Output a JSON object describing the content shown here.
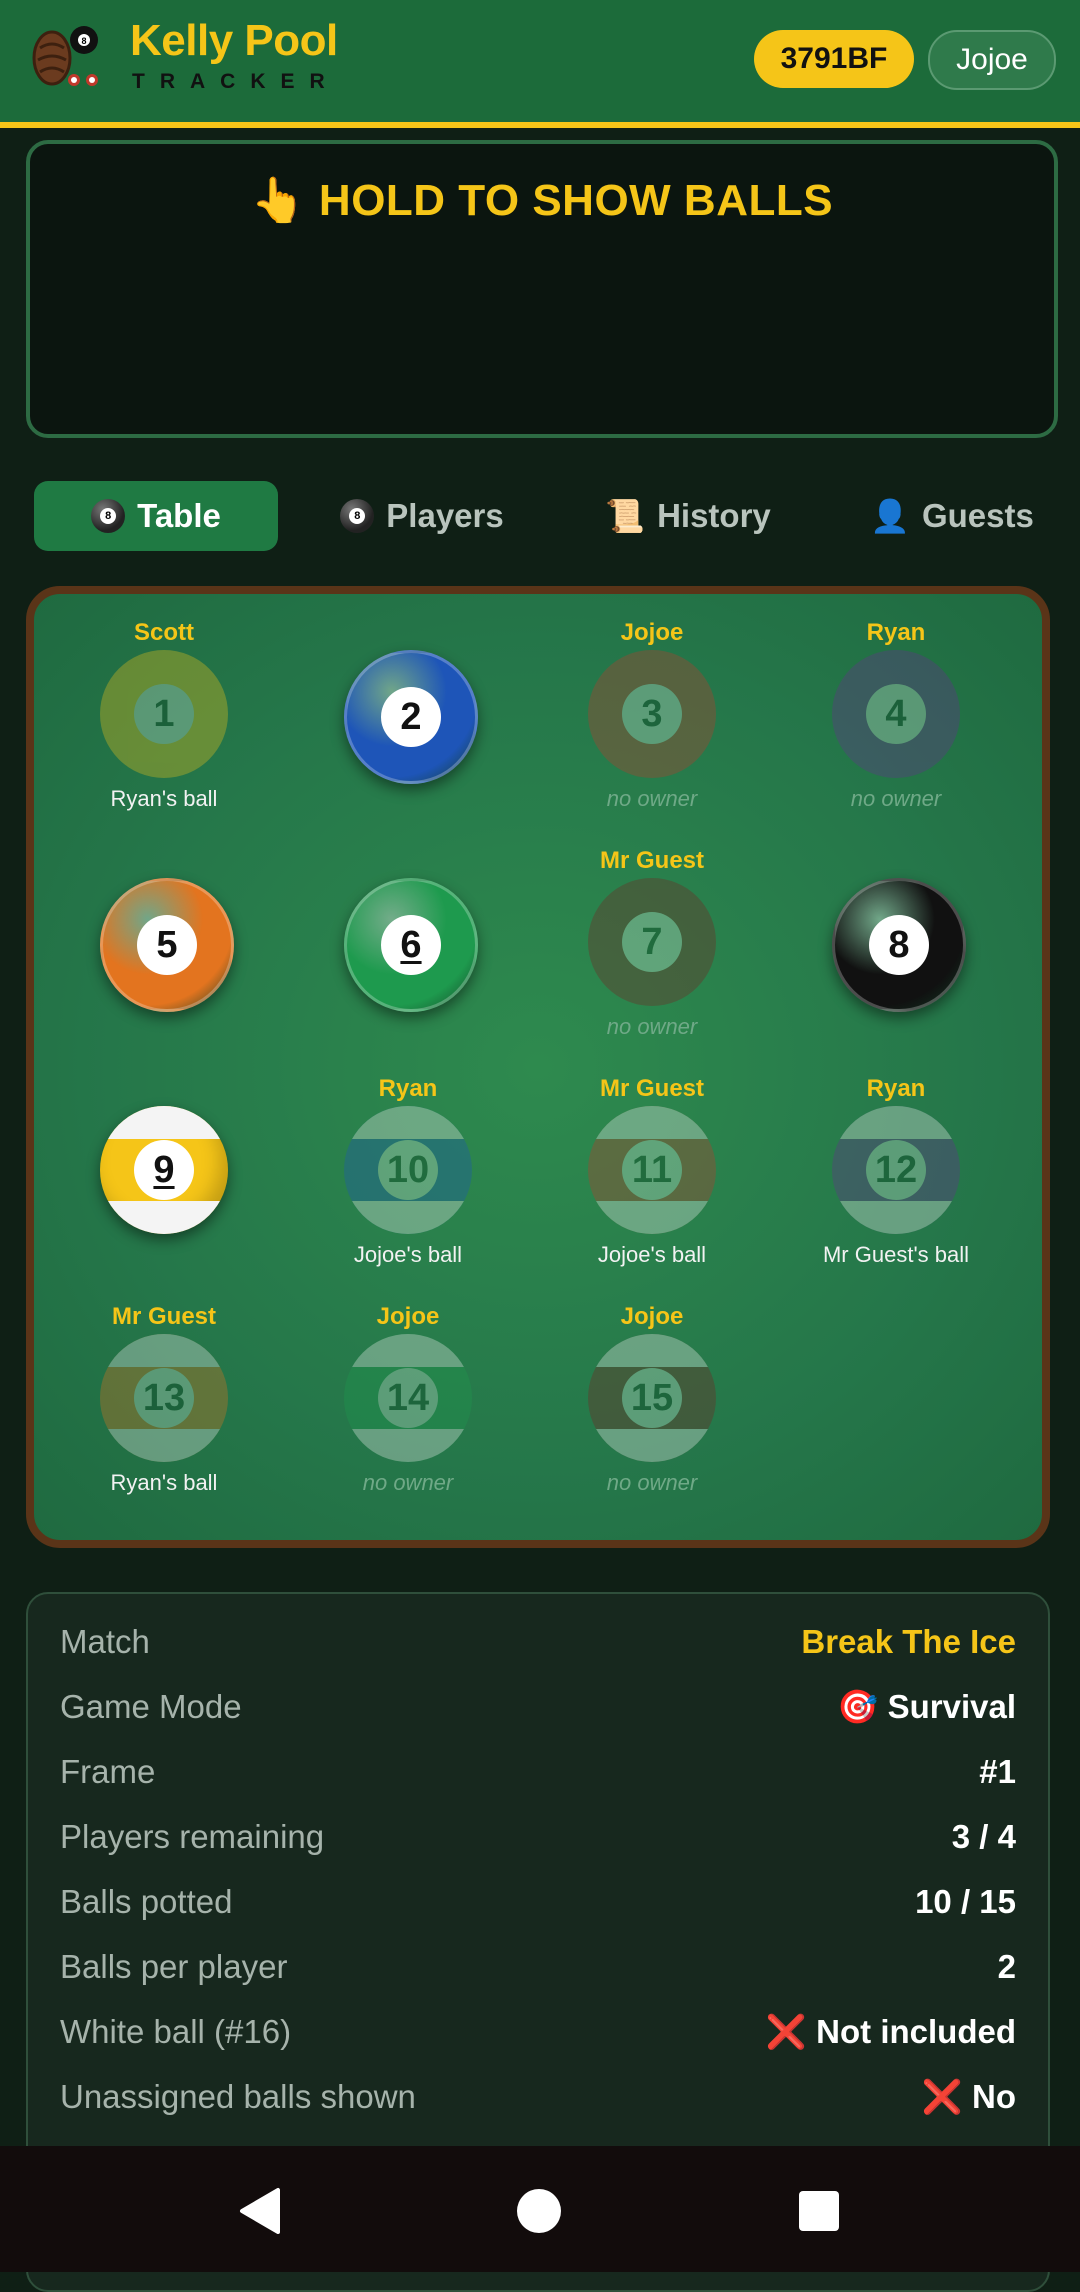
{
  "header": {
    "title": "Kelly Pool",
    "subtitle": "TRACKER",
    "room_code": "3791BF",
    "user": "Jojoe"
  },
  "hold_panel": {
    "text": "👆 HOLD TO SHOW BALLS"
  },
  "tabs": [
    {
      "label": "Table",
      "icon": "eight-ball-icon",
      "active": true
    },
    {
      "label": "Players",
      "icon": "eight-ball-icon",
      "active": false
    },
    {
      "label": "History",
      "icon": "📜",
      "active": false
    },
    {
      "label": "Guests",
      "icon": "👤",
      "active": false
    }
  ],
  "balls": [
    {
      "number": "1",
      "owner": "Scott",
      "sub": "Ryan's ball",
      "potted": true,
      "color": "#f5c518",
      "striped": false
    },
    {
      "number": "2",
      "owner": "",
      "sub": "",
      "potted": false,
      "color": "#1e55b8",
      "striped": false
    },
    {
      "number": "3",
      "owner": "Jojoe",
      "sub": "no owner",
      "potted": true,
      "color": "#c0392b",
      "striped": false
    },
    {
      "number": "4",
      "owner": "Ryan",
      "sub": "no owner",
      "potted": true,
      "color": "#6a2c91",
      "striped": false
    },
    {
      "number": "5",
      "owner": "",
      "sub": "",
      "potted": false,
      "color": "#e3741f",
      "striped": false
    },
    {
      "number": "6",
      "owner": "",
      "sub": "",
      "potted": false,
      "color": "#1e9a4e",
      "striped": false
    },
    {
      "number": "7",
      "owner": "Mr Guest",
      "sub": "no owner",
      "potted": true,
      "color": "#7a1f1f",
      "striped": false
    },
    {
      "number": "8",
      "owner": "",
      "sub": "",
      "potted": false,
      "color": "#111111",
      "striped": false
    },
    {
      "number": "9",
      "owner": "",
      "sub": "",
      "potted": false,
      "color": "#f5c518",
      "striped": true
    },
    {
      "number": "10",
      "owner": "Ryan",
      "sub": "Jojoe's ball",
      "potted": true,
      "color": "#1e55b8",
      "striped": true
    },
    {
      "number": "11",
      "owner": "Mr Guest",
      "sub": "Jojoe's ball",
      "potted": true,
      "color": "#c0392b",
      "striped": true
    },
    {
      "number": "12",
      "owner": "Ryan",
      "sub": "Mr Guest's ball",
      "potted": true,
      "color": "#6a2c91",
      "striped": true
    },
    {
      "number": "13",
      "owner": "Mr Guest",
      "sub": "Ryan's ball",
      "potted": true,
      "color": "#e3741f",
      "striped": true
    },
    {
      "number": "14",
      "owner": "Jojoe",
      "sub": "no owner",
      "potted": true,
      "color": "#1e9a4e",
      "striped": true
    },
    {
      "number": "15",
      "owner": "Jojoe",
      "sub": "no owner",
      "potted": true,
      "color": "#7a1f1f",
      "striped": true
    }
  ],
  "info": [
    {
      "label": "Match",
      "value": "Break The Ice",
      "accent": true
    },
    {
      "label": "Game Mode",
      "value": "🎯 Survival",
      "accent": false
    },
    {
      "label": "Frame",
      "value": "#1",
      "accent": false
    },
    {
      "label": "Players remaining",
      "value": "3 / 4",
      "accent": false
    },
    {
      "label": "Balls potted",
      "value": "10 / 15",
      "accent": false
    },
    {
      "label": "Balls per player",
      "value": "2",
      "accent": false
    },
    {
      "label": "White ball (#16)",
      "value": "❌ Not included",
      "accent": false
    },
    {
      "label": "Unassigned balls shown",
      "value": "❌ No",
      "accent": false
    }
  ]
}
